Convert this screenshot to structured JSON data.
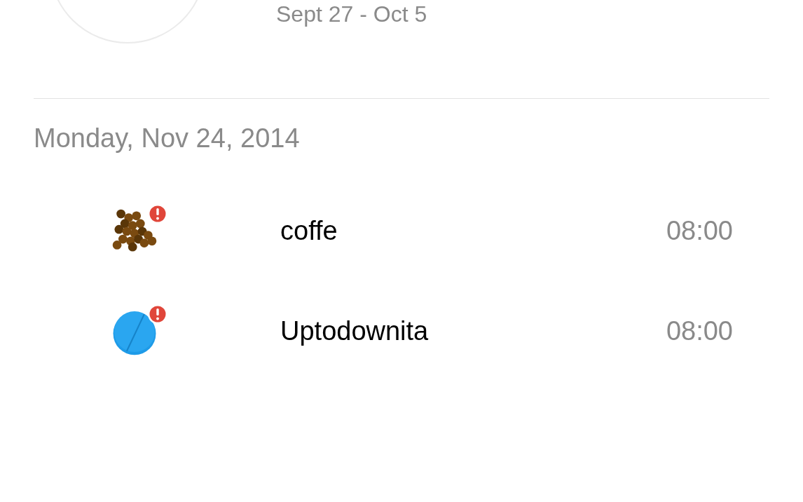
{
  "header": {
    "range": "Sept 27 - Oct 5"
  },
  "day": {
    "title": "Monday, Nov 24, 2014"
  },
  "entries": [
    {
      "kind": "beans",
      "name": "coffe",
      "time": "08:00",
      "alert": true
    },
    {
      "kind": "pill",
      "name": "Uptodownita",
      "time": "08:00",
      "alert": true
    }
  ]
}
